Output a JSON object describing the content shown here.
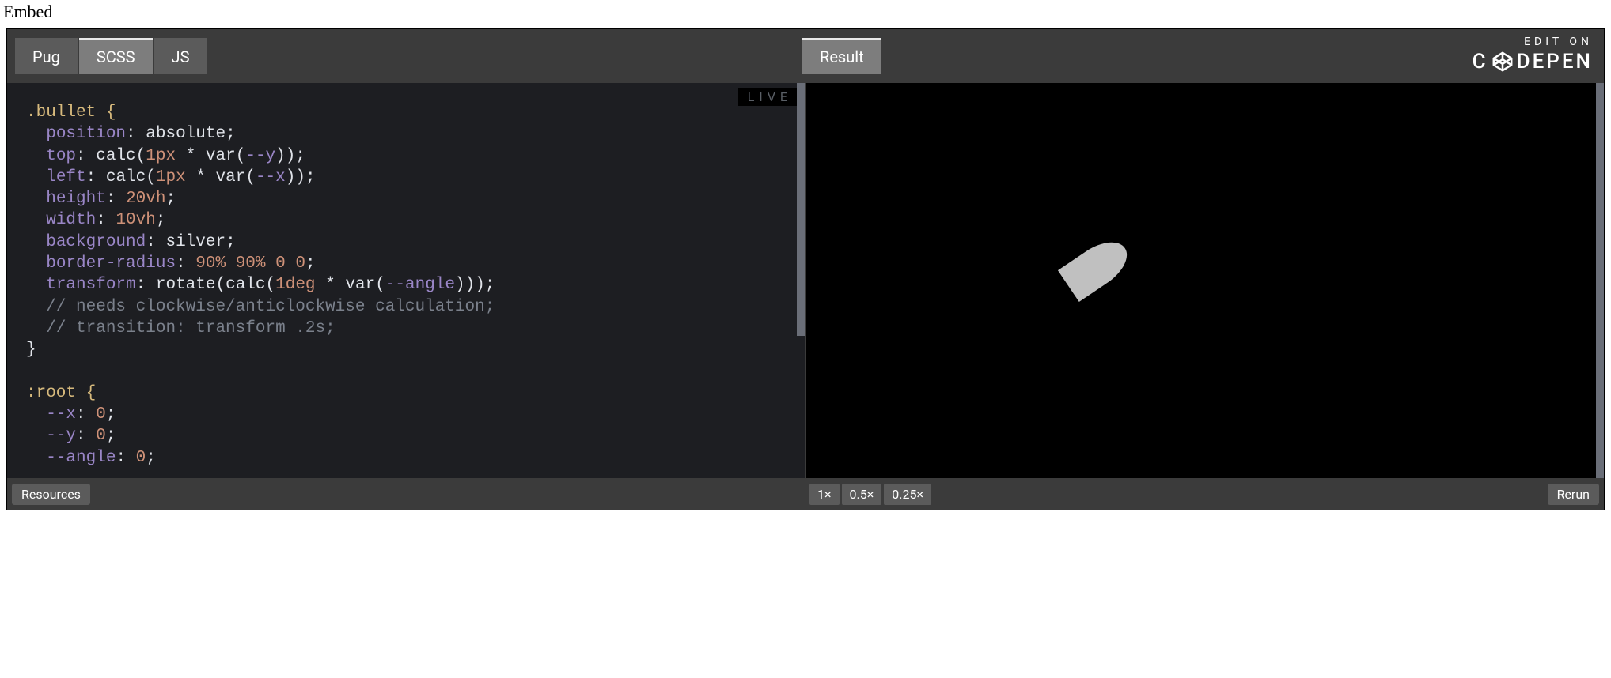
{
  "page_heading": "Embed",
  "tabs": {
    "pug": "Pug",
    "scss": "SCSS",
    "js": "JS",
    "result": "Result",
    "active": "scss"
  },
  "logo": {
    "edit_on": "EDIT ON",
    "brand": "C   DEPEN"
  },
  "live_badge": "LIVE",
  "code_lines": [
    {
      "t": "sel",
      "v": ".bullet {"
    },
    {
      "t": "prop",
      "k": "position",
      "v": "absolute",
      "valclass": "val"
    },
    {
      "t": "calcprop",
      "k": "top",
      "fn": "calc",
      "a": "1px",
      "op": "*",
      "vfn": "var",
      "varg": "--y"
    },
    {
      "t": "calcprop",
      "k": "left",
      "fn": "calc",
      "a": "1px",
      "op": "*",
      "vfn": "var",
      "varg": "--x"
    },
    {
      "t": "prop",
      "k": "height",
      "v": "20vh",
      "valclass": "num"
    },
    {
      "t": "prop",
      "k": "width",
      "v": "10vh",
      "valclass": "num"
    },
    {
      "t": "prop",
      "k": "background",
      "v": "silver",
      "valclass": "val"
    },
    {
      "t": "radii",
      "k": "border-radius",
      "a": "90%",
      "b": "90%",
      "c": "0",
      "d": "0"
    },
    {
      "t": "xform",
      "k": "transform",
      "fn": "rotate",
      "inner_fn": "calc",
      "a": "1deg",
      "op": "*",
      "vfn": "var",
      "varg": "--angle"
    },
    {
      "t": "com",
      "v": "// needs clockwise/anticlockwise calculation;"
    },
    {
      "t": "com",
      "v": "// transition: transform .2s;"
    },
    {
      "t": "close",
      "v": "}"
    },
    {
      "t": "blank",
      "v": ""
    },
    {
      "t": "sel",
      "v": ":root {"
    },
    {
      "t": "cvar",
      "k": "--x",
      "v": "0"
    },
    {
      "t": "cvar",
      "k": "--y",
      "v": "0"
    },
    {
      "t": "cvar",
      "k": "--angle",
      "v": "0"
    }
  ],
  "bottom": {
    "resources": "Resources",
    "rerun": "Rerun"
  },
  "zoom": {
    "x1": "1×",
    "x05": "0.5×",
    "x025": "0.25×",
    "active": "x1"
  },
  "result_shape": {
    "type": "bullet",
    "rotate_deg": 56,
    "color": "#c0c0c0"
  }
}
